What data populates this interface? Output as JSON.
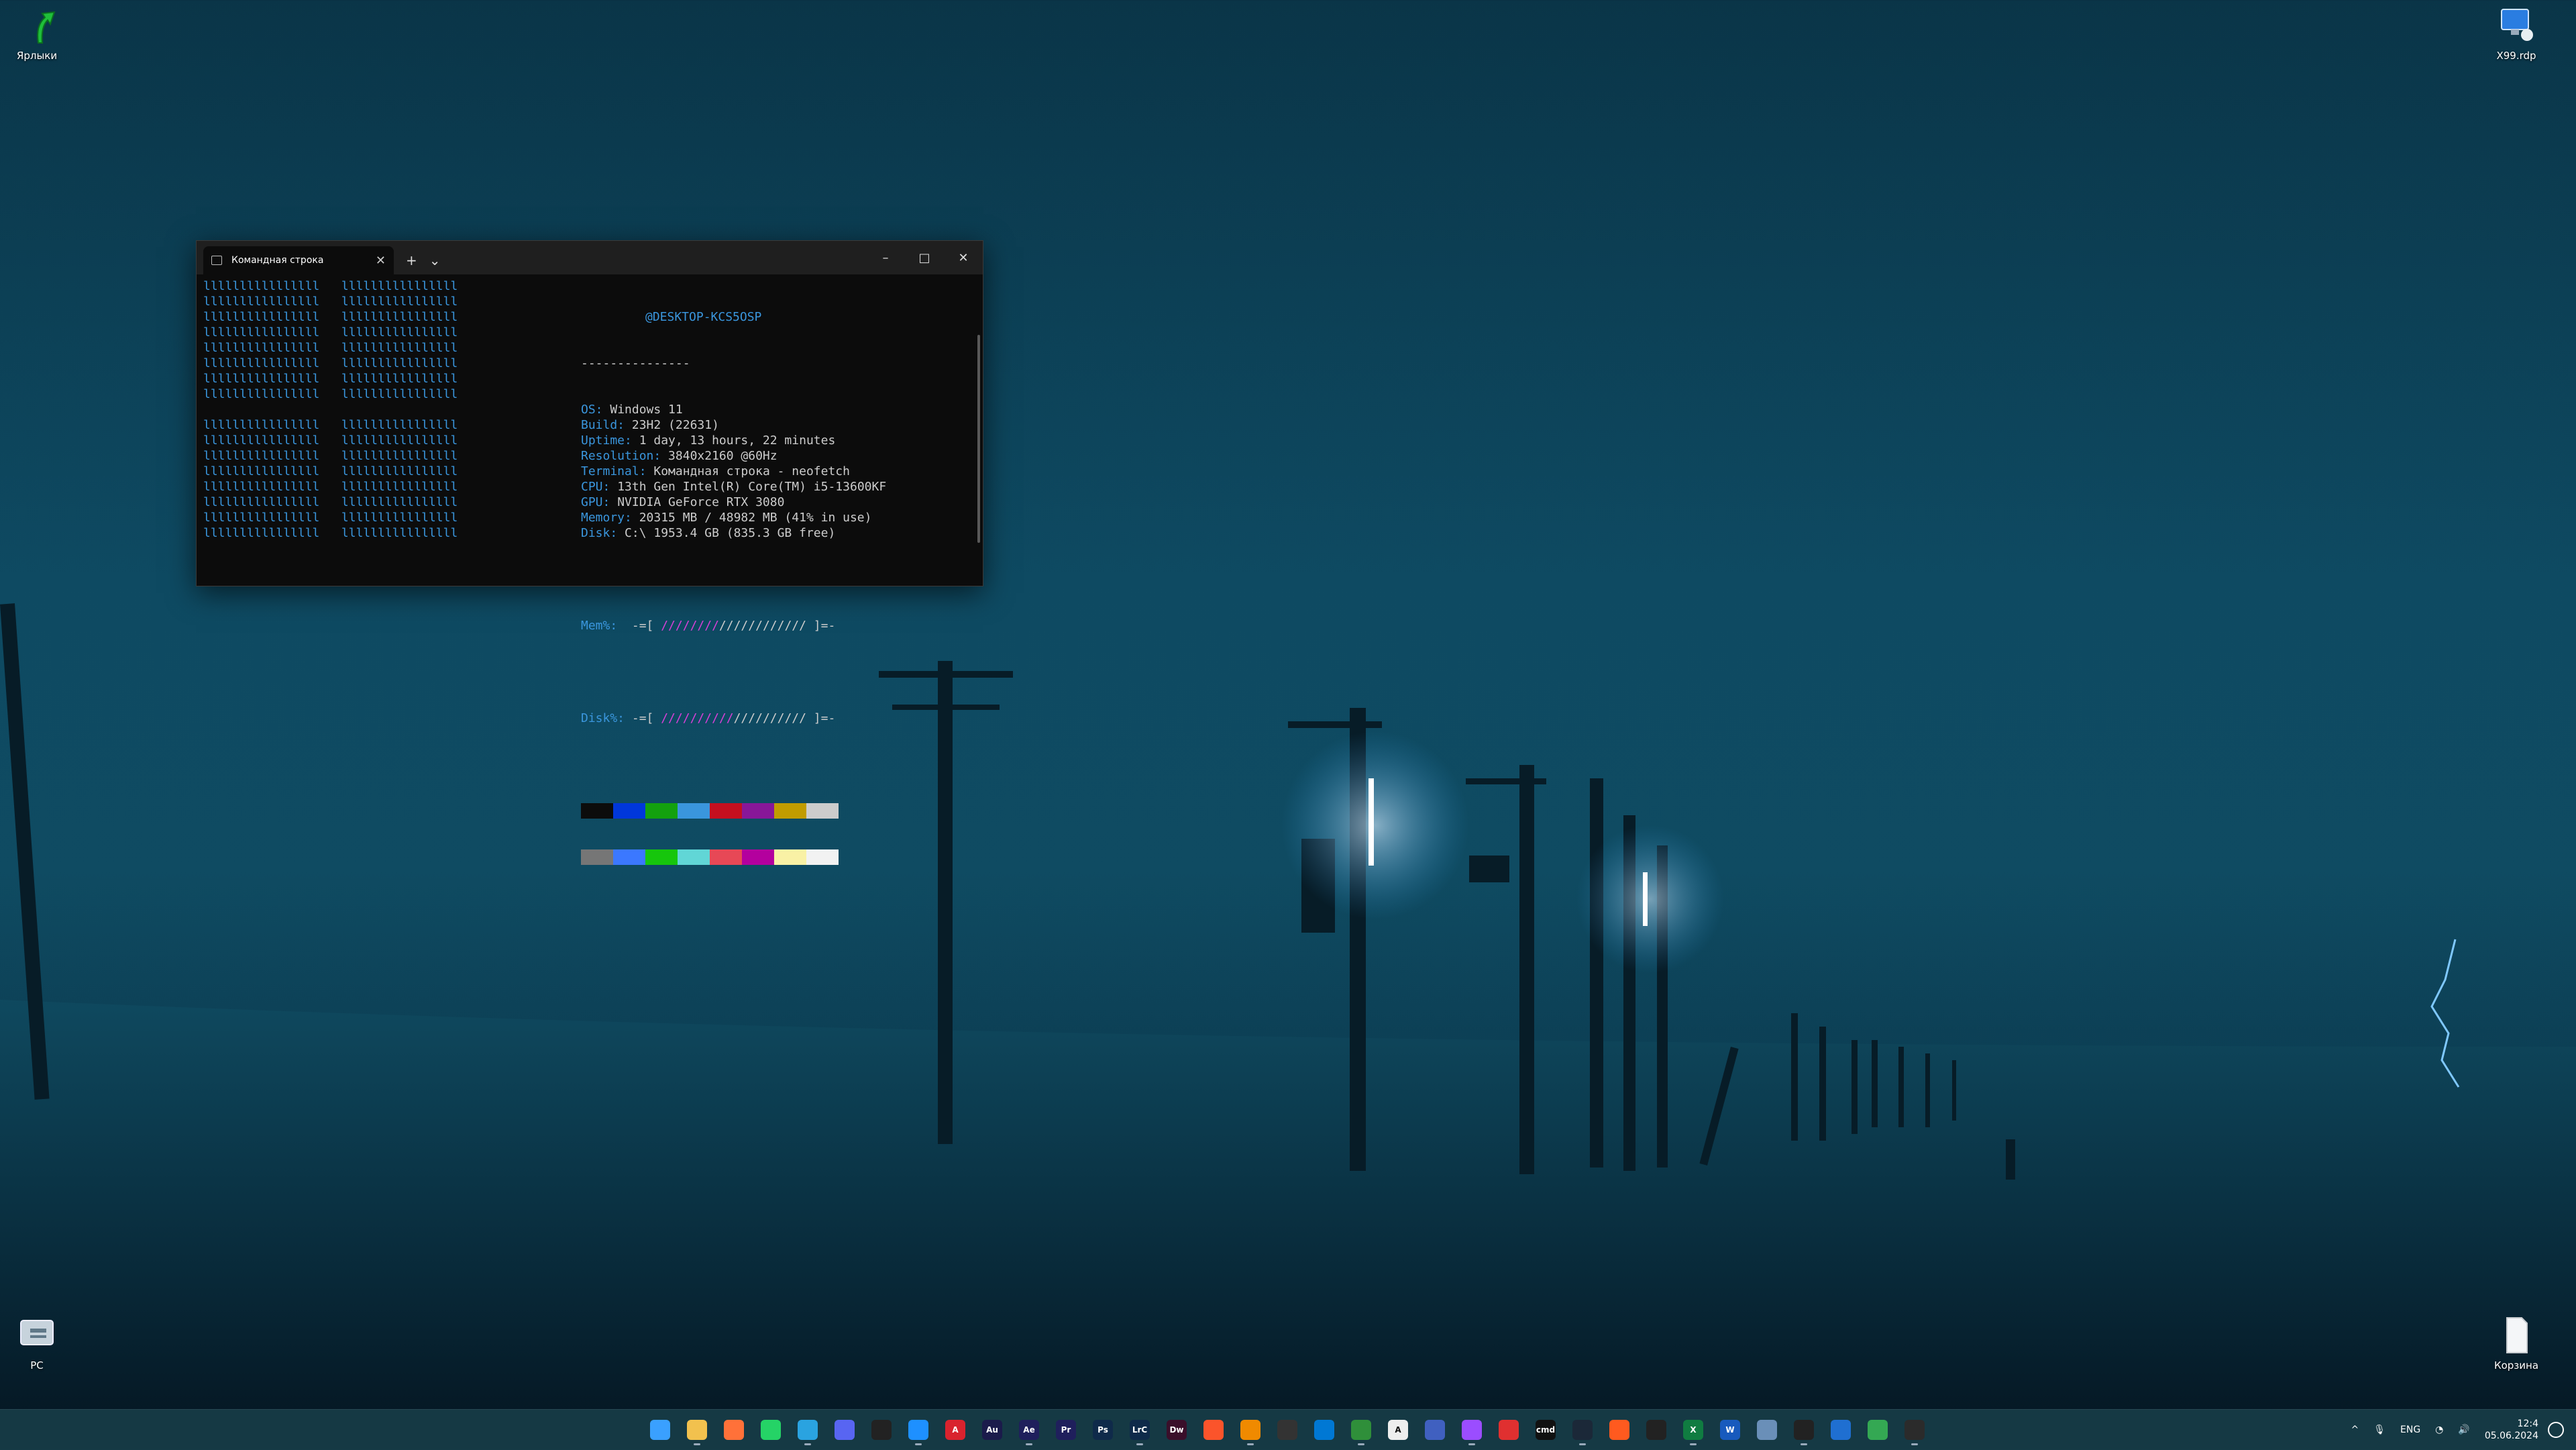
{
  "desktop": {
    "icons": [
      {
        "label": "Ярлыки",
        "icon": "green-arrow-icon"
      },
      {
        "label": "X99.rdp",
        "icon": "remote-desktop-icon"
      },
      {
        "label": "PC",
        "icon": "computer-icon"
      },
      {
        "label": "Корзина",
        "icon": "recycle-bin-icon"
      }
    ]
  },
  "terminal": {
    "tab_title": "Командная строка",
    "new_tab": "+",
    "dropdown": "⌄",
    "minimize": "–",
    "maximize": "□",
    "close": "✕",
    "logo_line": "llllllllllllllll   llllllllllllllll",
    "header": "@DESKTOP-KCS5OSP",
    "separator": "---------------",
    "info": [
      {
        "key": "OS:",
        "value": " Windows 11"
      },
      {
        "key": "Build:",
        "value": " 23H2 (22631)"
      },
      {
        "key": "Uptime:",
        "value": " 1 day, 13 hours, 22 minutes"
      },
      {
        "key": "Resolution:",
        "value": " 3840x2160 @60Hz"
      },
      {
        "key": "Terminal:",
        "value": " Командная строка - neofetch"
      },
      {
        "key": "CPU:",
        "value": " 13th Gen Intel(R) Core(TM) i5-13600KF"
      },
      {
        "key": "GPU:",
        "value": " NVIDIA GeForce RTX 3080"
      },
      {
        "key": "Memory:",
        "value": " 20315 MB / 48982 MB (41% in use)"
      },
      {
        "key": "Disk:",
        "value": " C:\\ 1953.4 GB (835.3 GB free)"
      }
    ],
    "mem": {
      "key": "Mem%:",
      "prefix": "  -=[ ",
      "used": "////////",
      "free": "////////////",
      "suffix": " ]=-"
    },
    "disk": {
      "key": "Disk%:",
      "prefix": " -=[ ",
      "used": "//////////",
      "free": "//////////",
      "suffix": " ]=-"
    },
    "palette_top": [
      "#0c0c0c",
      "#0037da",
      "#13a10e",
      "#3a96dd",
      "#c50f1f",
      "#881798",
      "#c19c00",
      "#cccccc"
    ],
    "palette_bottom": [
      "#767676",
      "#3b78ff",
      "#16c60c",
      "#61d6d6",
      "#e74856",
      "#b4009e",
      "#f9f1a5",
      "#f2f2f2"
    ]
  },
  "taskbar": {
    "apps": [
      {
        "name": "start",
        "label": "",
        "color": "#3aa0ff"
      },
      {
        "name": "file-explorer",
        "label": "",
        "color": "#f2c14e"
      },
      {
        "name": "firefox",
        "label": "",
        "color": "#ff7139"
      },
      {
        "name": "whatsapp",
        "label": "",
        "color": "#25d366"
      },
      {
        "name": "telegram",
        "label": "",
        "color": "#2aa3e0"
      },
      {
        "name": "discord",
        "label": "",
        "color": "#5865f2"
      },
      {
        "name": "app-yellow",
        "label": "",
        "color": "#222"
      },
      {
        "name": "app-blue-circle",
        "label": "",
        "color": "#1e90ff"
      },
      {
        "name": "acrobat",
        "label": "A",
        "color": "#d9232e"
      },
      {
        "name": "audition",
        "label": "Au",
        "color": "#1b1b4b"
      },
      {
        "name": "after-effects",
        "label": "Ae",
        "color": "#1f1f5c"
      },
      {
        "name": "premiere",
        "label": "Pr",
        "color": "#1f1f5c"
      },
      {
        "name": "photoshop",
        "label": "Ps",
        "color": "#0f2a4a"
      },
      {
        "name": "lightroom",
        "label": "LrC",
        "color": "#0f2a4a"
      },
      {
        "name": "dreamweaver",
        "label": "Dw",
        "color": "#3a0f2a"
      },
      {
        "name": "brave",
        "label": "",
        "color": "#fb542b"
      },
      {
        "name": "vlc",
        "label": "",
        "color": "#f08a00"
      },
      {
        "name": "github",
        "label": "",
        "color": "#333"
      },
      {
        "name": "vscode",
        "label": "",
        "color": "#0078d4"
      },
      {
        "name": "app-green",
        "label": "",
        "color": "#2f8f3a"
      },
      {
        "name": "app-white-a",
        "label": "A",
        "color": "#eee"
      },
      {
        "name": "app-rdp",
        "label": "",
        "color": "#4060c0"
      },
      {
        "name": "app-purple",
        "label": "",
        "color": "#9b4dff"
      },
      {
        "name": "app-red",
        "label": "",
        "color": "#e03030"
      },
      {
        "name": "app-dark",
        "label": "cmd",
        "color": "#111"
      },
      {
        "name": "steam",
        "label": "",
        "color": "#1b2838"
      },
      {
        "name": "app-orange",
        "label": "",
        "color": "#ff5a1f"
      },
      {
        "name": "app-screen",
        "label": "",
        "color": "#222"
      },
      {
        "name": "excel",
        "label": "X",
        "color": "#107c41"
      },
      {
        "name": "word",
        "label": "W",
        "color": "#185abd"
      },
      {
        "name": "app-globe",
        "label": "",
        "color": "#6a8fb8"
      },
      {
        "name": "app-meta",
        "label": "",
        "color": "#222"
      },
      {
        "name": "app-mail",
        "label": "",
        "color": "#1f6fd1"
      },
      {
        "name": "chrome",
        "label": "",
        "color": "#34a853"
      },
      {
        "name": "terminal",
        "label": "",
        "color": "#2b2b2b"
      }
    ],
    "tray": {
      "chevron": "^",
      "mic": "🎙",
      "lang": "ENG",
      "wifi": "◔",
      "volume": "🔊",
      "time": "12:4",
      "date": "05.06.2024"
    }
  }
}
